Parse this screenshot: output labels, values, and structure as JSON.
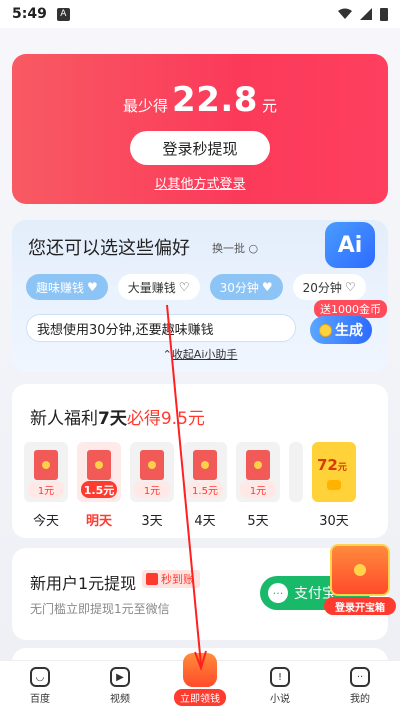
{
  "status_bar": {
    "time": "5:49",
    "badge": "A"
  },
  "hero": {
    "prefix": "最少得",
    "amount": "22.8",
    "unit": "元",
    "login_button": "登录秒提现",
    "other_login": "以其他方式登录"
  },
  "ai": {
    "title": "您还可以选这些偏好",
    "swap": "换一批",
    "logo": "Ai",
    "chips": [
      {
        "label": "趣味赚钱",
        "selected": true
      },
      {
        "label": "大量赚钱",
        "selected": false
      },
      {
        "label": "30分钟",
        "selected": true
      },
      {
        "label": "20分钟",
        "selected": false
      }
    ],
    "input_value": "我想使用30分钟,还要趣味赚钱",
    "gift_tag": "送1000金币",
    "generate_button": "生成",
    "collapse": "收起Ai小助手"
  },
  "welfare": {
    "title_a": "新人福利",
    "title_b": "7天",
    "title_c": "必得9.5元",
    "days": [
      {
        "amount": "1元",
        "label": "今天",
        "active": false
      },
      {
        "amount": "1.5元",
        "label": "明天",
        "active": true
      },
      {
        "amount": "1元",
        "label": "3天",
        "active": false
      },
      {
        "amount": "1.5元",
        "label": "4天",
        "active": false
      },
      {
        "amount": "1元",
        "label": "5天",
        "active": false
      }
    ],
    "big_day": {
      "amount": "72",
      "unit": "元",
      "label": "30天"
    }
  },
  "withdraw": {
    "title": "新用户1元提现",
    "badge": "秒到账",
    "subtitle": "无门槛立即提现1元至微信",
    "pay_button": "支付宝"
  },
  "treasure": {
    "label": "登录开宝箱"
  },
  "nav": [
    {
      "label": "百度"
    },
    {
      "label": "视频"
    },
    {
      "label": "立即领钱"
    },
    {
      "label": "小说"
    },
    {
      "label": "我的"
    }
  ],
  "colors": {
    "accent_red": "#ff3b30",
    "ai_blue": "#2e6bff",
    "pay_green": "#19b96a"
  }
}
